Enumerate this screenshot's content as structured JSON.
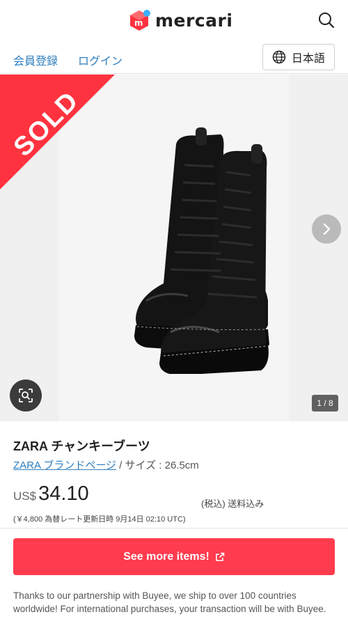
{
  "header": {
    "logo_text": "mercari",
    "logo_mark_letter": "m",
    "brand_color": "#ff333f",
    "search_icon": "search-icon"
  },
  "subheader": {
    "register_label": "会員登録",
    "login_label": "ログイン",
    "language_label": "日本語",
    "language_icon": "globe-icon"
  },
  "gallery": {
    "sold_label": "SOLD",
    "counter": "1 / 8",
    "next_icon": "chevron-right-icon",
    "lens_icon": "image-search-icon"
  },
  "item": {
    "title": "ZARA チャンキーブーツ",
    "brand_link": "ZARA ブランドページ",
    "size_text": " / サイズ : 26.5cm",
    "currency": "US$",
    "price": "34.10",
    "tax_note": "(税込) 送料込み",
    "rate_note": "(￥4,800 為替レート更新日時 9月14日 02:10 UTC)"
  },
  "cta": {
    "label": "See more items!",
    "color": "#ff3b4e",
    "icon": "external-link-icon"
  },
  "notice": {
    "text": "Thanks to our partnership with Buyee, we ship to over 100 countries worldwide! For international purchases, your transaction will be with Buyee."
  }
}
